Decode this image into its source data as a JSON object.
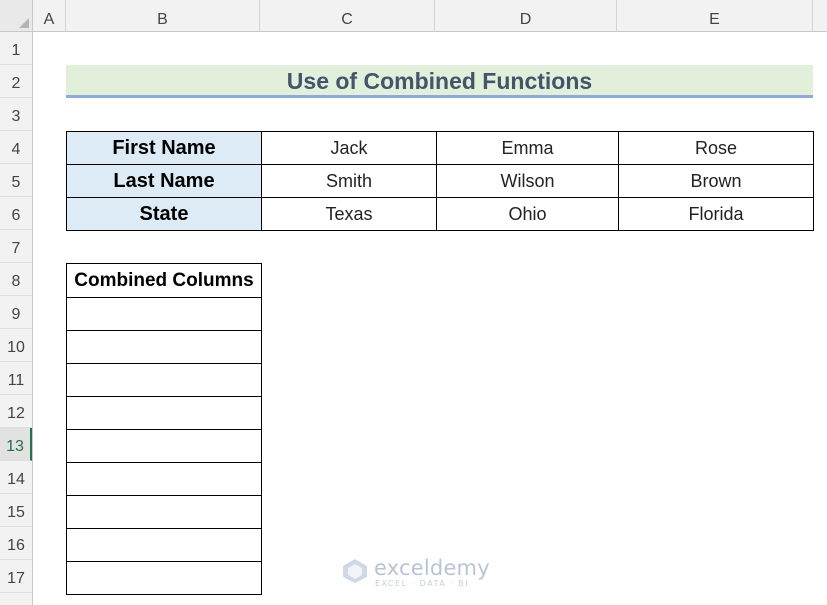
{
  "columns": [
    "A",
    "B",
    "C",
    "D",
    "E"
  ],
  "rows": [
    "1",
    "2",
    "3",
    "4",
    "5",
    "6",
    "7",
    "8",
    "9",
    "10",
    "11",
    "12",
    "13",
    "14",
    "15",
    "16",
    "17"
  ],
  "active_row": "13",
  "title": "Use of Combined Functions",
  "info_table": [
    {
      "header": "First Name",
      "values": [
        "Jack",
        "Emma",
        "Rose"
      ]
    },
    {
      "header": "Last Name",
      "values": [
        "Smith",
        "Wilson",
        "Brown"
      ]
    },
    {
      "header": "State",
      "values": [
        "Texas",
        "Ohio",
        "Florida"
      ]
    }
  ],
  "combined": {
    "header": "Combined Columns",
    "cells": [
      "",
      "",
      "",
      "",
      "",
      "",
      "",
      "",
      ""
    ]
  },
  "watermark": {
    "name": "exceldemy",
    "tagline": "EXCEL · DATA · BI"
  },
  "colors": {
    "title_fill": "#e2efda",
    "title_underline": "#8ea9db",
    "title_text": "#44546a",
    "header_fill": "#ddebf7",
    "active_row": "#217346"
  }
}
